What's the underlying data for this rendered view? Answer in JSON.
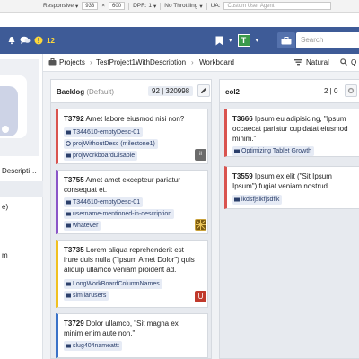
{
  "devtools": {
    "device": "Responsive",
    "width": "933",
    "height": "600",
    "dpr": "DPR: 1",
    "throttle": "No Throttling",
    "ua_label": "UA:",
    "ua_placeholder": "Custom User Agent"
  },
  "topnav": {
    "notification_count": "12",
    "avatar_letter": "T",
    "search_placeholder": "Search"
  },
  "breadcrumbs": {
    "projects": "Projects",
    "project": "TestProject1WithDescription",
    "workboard": "Workboard",
    "natural": "Natural",
    "more": "Q"
  },
  "left_panel": {
    "item_desc": "Descripti…",
    "item_e": "e)",
    "item_m": "m"
  },
  "colors": {
    "nav": "#3e5b97",
    "card_red": "#d9534f",
    "card_purple": "#8a55c8",
    "card_yellow": "#f0c020",
    "card_blue": "#3a72c8"
  },
  "columns": [
    {
      "title": "Backlog",
      "subtitle": "(Default)",
      "points": "92 | 320998",
      "cards": [
        {
          "id": "T3792",
          "title": "Amet labore eiusmod nisi non?",
          "tags": [
            "T344610-emptyDesc-01",
            "projWithoutDesc (milestone1)",
            "projWorkboardDisable"
          ],
          "owner": "il"
        },
        {
          "id": "T3755",
          "title": "Amet amet excepteur pariatur consequat et.",
          "tags": [
            "T344610-emptyDesc-01",
            "username-mentioned-in-description",
            "whatever"
          ],
          "owner": ""
        },
        {
          "id": "T3735",
          "title": "Lorem aliqua reprehenderit est irure duis nulla (\"Ipsum Amet Dolor\") quis aliquip ullamco veniam proident ad.",
          "tags": [
            "LongWorkBoardColumnNames",
            "similarusers"
          ],
          "owner": "U"
        },
        {
          "id": "T3729",
          "title": "Dolor ullamco, \"Sit magna ex minim enim aute non.\"",
          "tags": [
            "slug404nameattt"
          ],
          "owner": ""
        }
      ]
    },
    {
      "title": "col2",
      "subtitle": "",
      "points": "2 | 0",
      "cards": [
        {
          "id": "T3666",
          "title": "Ipsum eu adipisicing, \"Ipsum occaecat pariatur cupidatat eiusmod minim.\"",
          "tags": [
            "Optimizing Tablet Growth"
          ],
          "owner": ""
        },
        {
          "id": "T3559",
          "title": "Ipsum ex elit (\"Sit Ipsum Ipsum\") fugiat veniam nostrud.",
          "tags": [
            "lkdsfjslkfjsdflk"
          ],
          "owner": ""
        }
      ]
    }
  ]
}
